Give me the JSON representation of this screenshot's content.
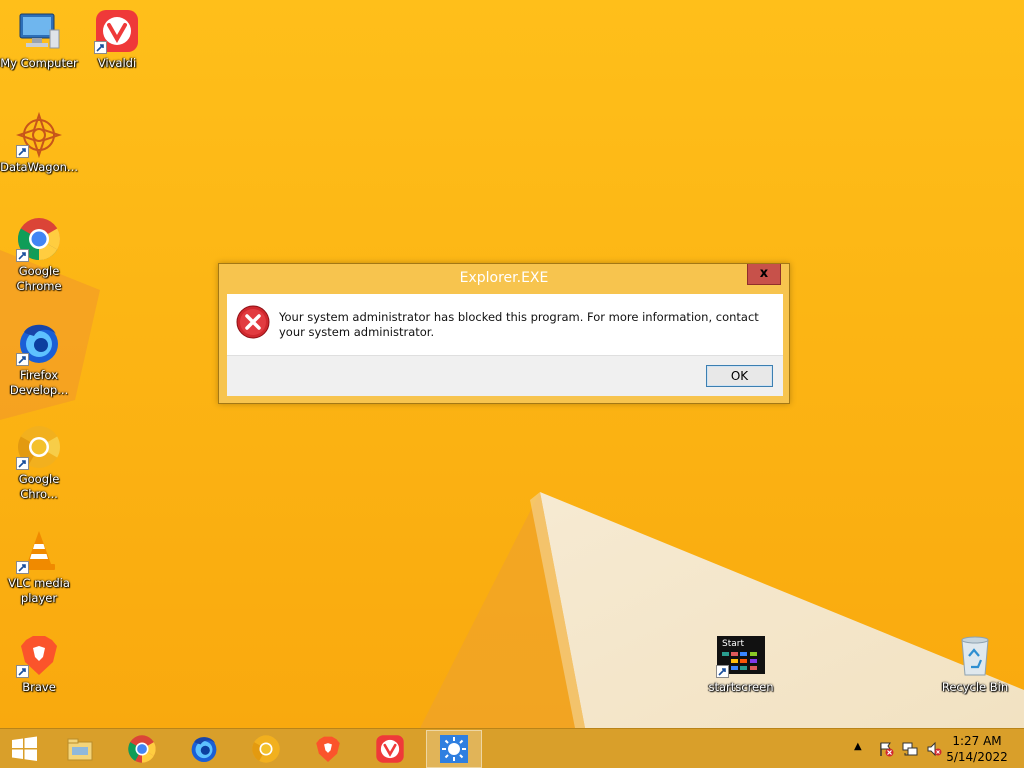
{
  "desktop": {
    "icons": [
      {
        "label": "My Computer",
        "icon": "computer-icon"
      },
      {
        "label": "Vivaldi",
        "icon": "vivaldi-icon"
      },
      {
        "label": "DataWagon...",
        "icon": "datawagon-icon"
      },
      {
        "label": "Google Chrome",
        "icon": "chrome-icon"
      },
      {
        "label": "Firefox Develop...",
        "icon": "firefox-developer-icon"
      },
      {
        "label": "Google Chro...",
        "icon": "chrome-canary-icon"
      },
      {
        "label": "VLC media player",
        "icon": "vlc-icon"
      },
      {
        "label": "Brave",
        "icon": "brave-icon"
      },
      {
        "label": "startscreen",
        "icon": "startscreen-icon"
      },
      {
        "label": "Recycle Bin",
        "icon": "recycle-bin-icon"
      }
    ],
    "startscreen_thumb_text": "Start"
  },
  "dialog": {
    "title": "Explorer.EXE",
    "close_label": "x",
    "message": "Your system administrator has blocked this program. For more information, contact your system administrator.",
    "ok_label": "OK"
  },
  "taskbar": {
    "pinned": [
      "file-explorer-icon",
      "chrome-icon",
      "firefox-developer-icon",
      "chrome-canary-icon",
      "brave-icon",
      "vivaldi-icon",
      "app-sun-icon"
    ],
    "tray_icons": [
      "show-hidden-icons-chevron",
      "action-center-flag-icon",
      "network-icon",
      "volume-muted-icon"
    ],
    "time": "1:27 AM",
    "date": "5/14/2022"
  },
  "colors": {
    "wallpaper": "#fcb514",
    "taskbar": "#d99f2a",
    "dialog_frame": "#f7c44e",
    "close_button": "#c7514a",
    "error_red": "#d0282e"
  }
}
